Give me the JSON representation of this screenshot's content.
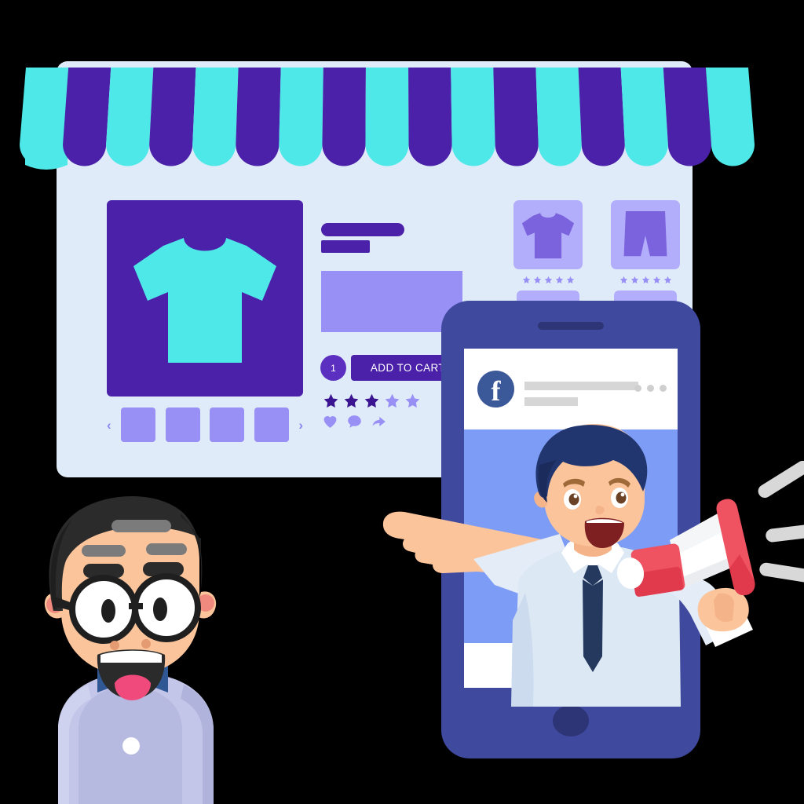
{
  "scene": {
    "title": "Social Media E-commerce Store Illustration",
    "background": "#000000"
  },
  "colors": {
    "panel_bg": "#e0ebfa",
    "deep_purple": "#4a21a8",
    "cyan": "#4fe8e8",
    "light_purple": "#9890f5",
    "pale_purple": "#b3aefb",
    "phone_body": "#3f4a9e",
    "phone_screen_blue": "#7d9cf5",
    "facebook_blue": "#3b5998",
    "megaphone_red": "#ef5261",
    "shirt_blue": "#dde8f5",
    "tie_navy": "#25395e",
    "hair_navy": "#21356e",
    "skin": "#fbc49b",
    "lavender_shirt": "#c3c6e8",
    "bowtie_navy": "#2f5894"
  },
  "awning": {
    "name": "store-awning",
    "stripe_count": 17,
    "colors": [
      "#4fe8e8",
      "#4a21a8"
    ]
  },
  "storefront": {
    "main_product": {
      "image_alt": "t-shirt",
      "bg": "#4a21a8",
      "shirt_color": "#4fe8e8"
    },
    "carousel": {
      "prev_label": "‹",
      "next_label": "›",
      "thumb_count": 4
    },
    "product_info": {
      "title_placeholder": "",
      "subtitle_placeholder": "",
      "description_placeholder": ""
    },
    "add_to_cart": {
      "quantity": "1",
      "button_label": "ADD TO CART"
    },
    "rating": {
      "total": 5,
      "filled": 3,
      "filled_color": "#3b1591",
      "empty_color": "#9890f5"
    },
    "social_actions": [
      {
        "name": "like-heart-icon",
        "glyph": "heart"
      },
      {
        "name": "comment-icon",
        "glyph": "bubble"
      },
      {
        "name": "share-icon",
        "glyph": "arrow"
      }
    ],
    "side_products": [
      {
        "name": "t-shirt",
        "stars": 5,
        "has_button": true
      },
      {
        "name": "shorts",
        "stars": 5,
        "has_button": true
      }
    ]
  },
  "phone": {
    "post": {
      "brand": "f",
      "brand_name": "facebook",
      "line1_placeholder": "",
      "line2_placeholder": "",
      "menu_dots": 3
    },
    "character": {
      "name": "megaphone-man",
      "holding": "megaphone",
      "gesture": "pointing-left",
      "sound_waves": 3
    }
  },
  "foreground": {
    "character": {
      "name": "customer-man",
      "accessories": [
        "round-glasses",
        "bow-tie",
        "shirt-button"
      ],
      "expression": "smiling"
    }
  }
}
